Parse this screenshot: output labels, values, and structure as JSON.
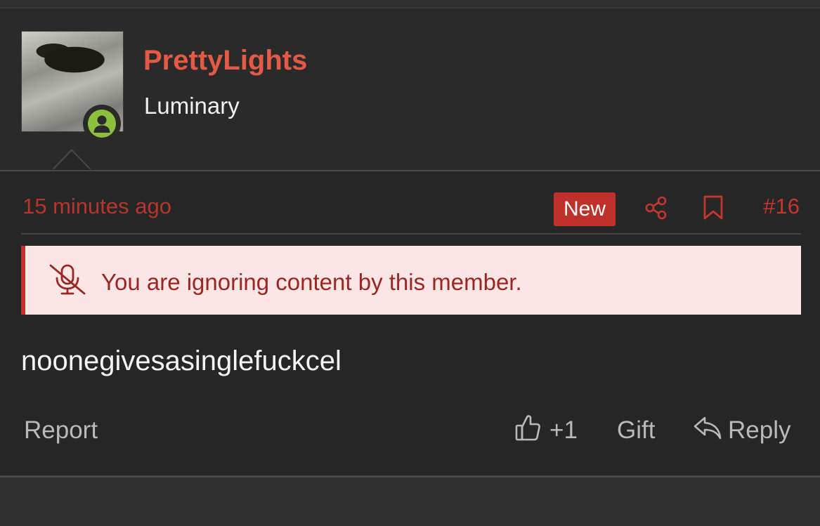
{
  "user": {
    "name": "PrettyLights",
    "title": "Luminary"
  },
  "meta": {
    "time": "15 minutes ago",
    "badge": "New",
    "post_number": "#16"
  },
  "notice": {
    "text": "You are ignoring content by this member."
  },
  "message": {
    "text": "noonegivesasinglefuckcel"
  },
  "actions": {
    "report": "Report",
    "like_count": "+1",
    "gift": "Gift",
    "reply": "Reply"
  },
  "icons": {
    "online": "user-online-icon",
    "share": "share-icon",
    "bookmark": "bookmark-icon",
    "ignore": "microphone-slash-icon",
    "like": "thumbs-up-icon",
    "reply": "reply-icon"
  },
  "colors": {
    "username": "#e55a46",
    "accent": "#c0302a",
    "online": "#8dc03f",
    "notice_bg": "#fbe6e6"
  }
}
